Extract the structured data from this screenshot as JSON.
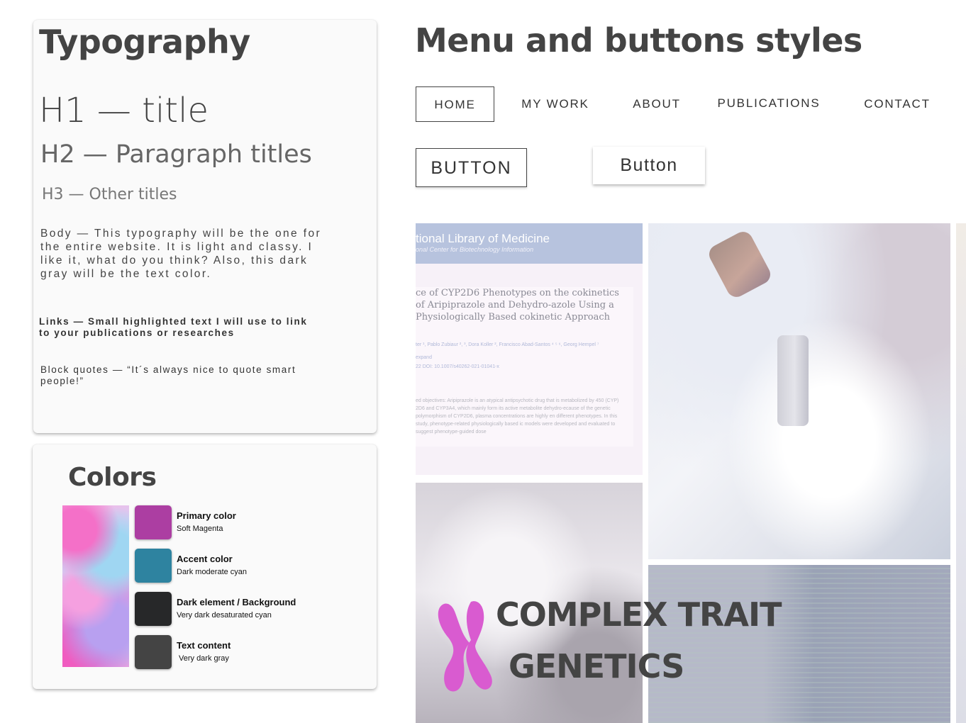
{
  "typography": {
    "title": "Typography",
    "h1": "H1 — title",
    "h2": "H2 —  Paragraph titles",
    "h3": "H3 — Other titles",
    "body": "Body —  This typography will be the one for the entire website. It is light and classy. I like it, what do you think? Also, this dark gray will be the text color.",
    "links": "Links — Small highlighted text I will use to link to your publications or researches",
    "quote": "Block quotes — “It´s always nice to quote smart people!”"
  },
  "colors": {
    "title": "Colors",
    "swatches": [
      {
        "name": "Primary color",
        "desc": "Soft Magenta",
        "hex": "#ac3ea2"
      },
      {
        "name": "Accent color",
        "desc": "Dark moderate cyan",
        "hex": "#2e83a0"
      },
      {
        "name": "Dark element / Background",
        "desc": "Very dark desaturated cyan",
        "hex": "#272829"
      },
      {
        "name": "Text content",
        "desc": "Very dark gray",
        "hex": "#444444"
      }
    ]
  },
  "menu": {
    "title": "Menu and buttons styles",
    "items": [
      "HOME",
      "MY WORK",
      "ABOUT",
      "PUBLICATIONS",
      "CONTACT"
    ],
    "button_outline": "BUTTON",
    "button_raised": "Button"
  },
  "collage": {
    "article": {
      "header_title": "tional Library of Medicine",
      "header_sub": "onal Center for Biotechnology Information",
      "title": "ce of CYP2D6 Phenotypes on the cokinetics of Aripiprazole and Dehydro-azole Using a Physiologically Based cokinetic Approach",
      "authors": "ter ¹, Pablo Zubiaur ², ³, Dora Koller ², Francisco Abad-Santos ⁴ ⁵ ⁶, Georg Hempel ⁷",
      "expand": "expand",
      "doi": "22   DOI: 10.1007/s40262-021-01041-x",
      "abstract": "ed objectives: Aripiprazole is an atypical antipsychotic drug that is metabolized by 450 (CYP) 2D6 and CYP3A4, which mainly form its active metabolite dehydro-ecause of the genetic polymorphism of CYP2D6, plasma concentrations are highly en different phenotypes. In this study, phenotype-related physiologically based ic models were developed and evaluated to suggest phenotype-guided dose"
    },
    "logo_line1": "COMPLEX TRAIT",
    "logo_line2": "GENETICS",
    "logo_color": "#d95bd0"
  }
}
